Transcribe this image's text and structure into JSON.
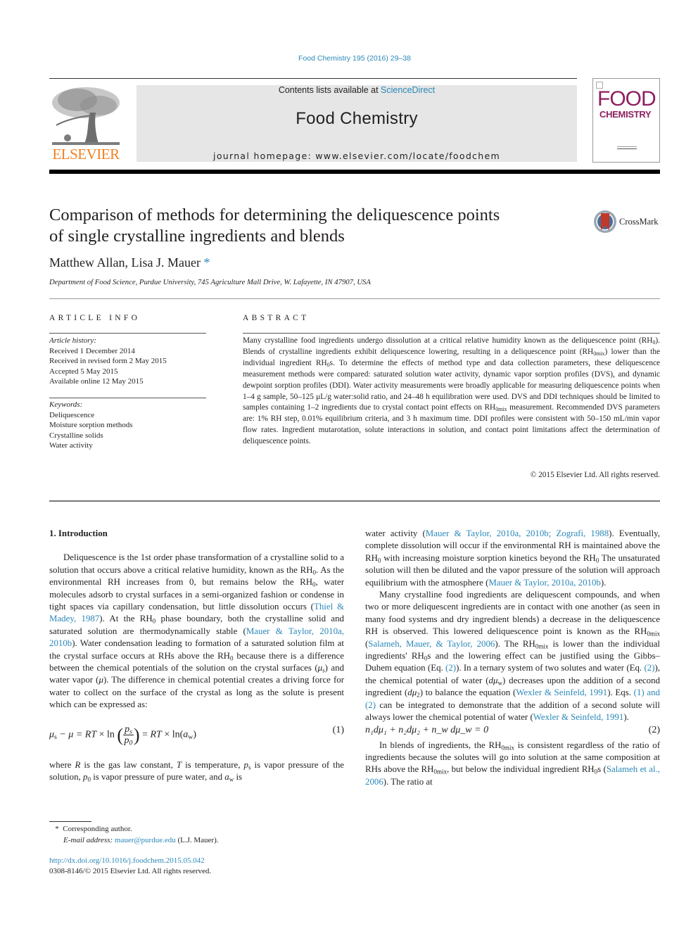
{
  "header": {
    "journal_ref": "Food Chemistry 195 (2016) 29–38",
    "contents_prefix": "Contents lists available at ",
    "contents_link": "ScienceDirect",
    "journal_title": "Food Chemistry",
    "homepage": "journal homepage: www.elsevier.com/locate/foodchem",
    "publisher_logo_text": "ELSEVIER",
    "cover_word1": "FOOD",
    "cover_word2": "CHEMISTRY",
    "colors": {
      "link": "#2a88b8",
      "elsevier_orange": "#f47f20",
      "cover_magenta": "#8e1f5f",
      "banner_bg": "#e6e6e6"
    }
  },
  "article": {
    "title_line1": "Comparison of methods for determining the deliquescence points",
    "title_line2": "of single crystalline ingredients and blends",
    "crossmark_label": "CrossMark",
    "authors": "Matthew Allan, Lisa J. Mauer",
    "author_mark": "*",
    "affiliation": "Department of Food Science, Purdue University, 745 Agriculture Mall Drive, W. Lafayette, IN 47907, USA"
  },
  "article_info": {
    "heading": "ARTICLE INFO",
    "history_label": "Article history:",
    "history": [
      "Received 1 December 2014",
      "Received in revised form 2 May 2015",
      "Accepted 5 May 2015",
      "Available online 12 May 2015"
    ],
    "keywords_label": "Keywords:",
    "keywords": [
      "Deliquescence",
      "Moisture sorption methods",
      "Crystalline solids",
      "Water activity"
    ]
  },
  "abstract": {
    "heading": "ABSTRACT",
    "t1": "Many crystalline food ingredients undergo dissolution at a critical relative humidity known as the deliquescence point (RH",
    "t2": "). Blends of crystalline ingredients exhibit deliquescence lowering, resulting in a deliquescence point (RH",
    "t3": ") lower than the individual ingredient RH",
    "t4": "s. To determine the effects of method type and data collection parameters, these deliquescence measurement methods were compared: saturated solution water activity, dynamic vapor sorption profiles (DVS), and dynamic dewpoint sorption profiles (DDI). Water activity measurements were broadly applicable for measuring deliquescence points when 1–4 g sample, 50–125 μL/g water:solid ratio, and 24–48 h equilibration were used. DVS and DDI techniques should be limited to samples containing 1–2 ingredients due to crystal contact point effects on RH",
    "t5": " measurement. Recommended DVS parameters are: 1% RH step, 0.01% equilibrium criteria, and 3 h maximum time. DDI profiles were consistent with 50–150 mL/min vapor flow rates. Ingredient mutarotation, solute interactions in solution, and contact point limitations affect the determination of deliquescence points.",
    "sub0": "0",
    "sub0mix": "0mix",
    "copyright": "© 2015 Elsevier Ltd. All rights reserved."
  },
  "body": {
    "intro_heading": "1. Introduction",
    "p1": {
      "a": "Deliquescence is the 1st order phase transformation of a crystalline solid to a solution that occurs above a critical relative humidity, known as the RH",
      "b": ". As the environmental RH increases from 0, but remains below the RH",
      "c": ", water molecules adsorb to crystal surfaces in a semi-organized fashion or condense in tight spaces via capillary condensation, but little dissolution occurs (",
      "cite1": "Thiel & Madey, 1987",
      "d": "). At the RH",
      "e": " phase boundary, both the crystalline solid and saturated solution are thermodynamically stable (",
      "cite2": "Mauer & Taylor, 2010a, 2010b",
      "f": "). Water condensation leading to formation of a saturated solution film at the crystal surface occurs at RHs above the RH",
      "g": " because there is a difference between the chemical potentials of the solution on the crystal surfaces (",
      "mu_s": "μ",
      "mu_s_sub": "s",
      "h": ") and water vapor (",
      "mu": "μ",
      "i": "). The difference in chemical potential creates a driving force for water to collect on the surface of the crystal as long as the solute is present which can be expressed as:"
    },
    "eq1": {
      "lhs": "μ",
      "lhs_sub": "s",
      "minus_mu": " − μ = ",
      "rt1": "RT",
      "times_ln": " × ln ",
      "num": "p",
      "num_sub": "s",
      "den": "p",
      "den_sub": "0",
      "eq_rt": " = ",
      "rt2": "RT",
      "times_ln2": " × ln(",
      "aw": "a",
      "aw_sub": "w",
      "close": ")",
      "number": "(1)"
    },
    "p2": {
      "a": "where ",
      "R": "R",
      "b": " is the gas law constant, ",
      "T": "T",
      "c": " is temperature, ",
      "ps": "p",
      "ps_sub": "s",
      "d": " is vapor pressure of the solution, ",
      "p0": "p",
      "p0_sub": "0",
      "e": " is vapor pressure of pure water, and ",
      "aw": "a",
      "aw_sub": "w",
      "f": " is"
    },
    "right": {
      "r1a": "water activity (",
      "r1cite": "Mauer & Taylor, 2010a, 2010b; Zografi, 1988",
      "r1b": "). Eventually, complete dissolution will occur if the environmental RH is maintained above the RH",
      "r1c": " with increasing moisture sorption kinetics beyond the RH",
      "r1d": " The unsaturated solution will then be diluted and the vapor pressure of the solution will approach equilibrium with the atmosphere (",
      "r1cite2": "Mauer & Taylor, 2010a, 2010b",
      "r1e": ").",
      "r2a": "Many crystalline food ingredients are deliquescent compounds, and when two or more deliquescent ingredients are in contact with one another (as seen in many food systems and dry ingredient blends) a decrease in the deliquescence RH is observed. This lowered deliquescence point is known as the RH",
      "r2cite1": "Salameh, Mauer, & Taylor, 2006",
      "r2b": "). The RH",
      "r2c": " is lower than the individual ingredients' RH",
      "r2d": "s and the lowering effect can be justified using the Gibbs–Duhem equation (Eq. ",
      "r2eq": "(2)",
      "r2e": "). In a ternary system of two solutes and water (Eq. ",
      "r2f": "), the chemical potential of water (",
      "dmuw": "dμ",
      "dmuw_sub": "w",
      "r2g": ") decreases upon the addition of a second ingredient (",
      "dmu2": "dμ",
      "dmu2_sub": "2",
      "r2h": ") to balance the equation (",
      "r2cite2": "Wexler & Seinfeld, 1991",
      "r2i": "). Eqs. ",
      "r2eqs": "(1) and (2)",
      "r2j": " can be integrated to demonstrate that the addition of a second solute will always lower the chemical potential of water (",
      "r2cite3": "Wexler & Seinfeld, 1991",
      "r2k": ").",
      "eq2_text": "n₁dμ₁ + n₂dμ₂ + n_w dμ_w = 0",
      "eq2_number": "(2)",
      "r3a": "In blends of ingredients, the RH",
      "r3b": " is consistent regardless of the ratio of ingredients because the solutes will go into solution at the same composition at RHs above the RH",
      "r3c": ", but below the individual ingredient RH",
      "r3d": "s (",
      "r3cite": "Salameh et al., 2006",
      "r3e": "). The ratio at"
    }
  },
  "footnote": {
    "mark": "*",
    "corresponding": "Corresponding author.",
    "email_label": "E-mail address:",
    "email": "mauer@purdue.edu",
    "email_suffix": " (L.J. Mauer).",
    "doi": "http://dx.doi.org/10.1016/j.foodchem.2015.05.042",
    "issn": "0308-8146/© 2015 Elsevier Ltd. All rights reserved."
  }
}
